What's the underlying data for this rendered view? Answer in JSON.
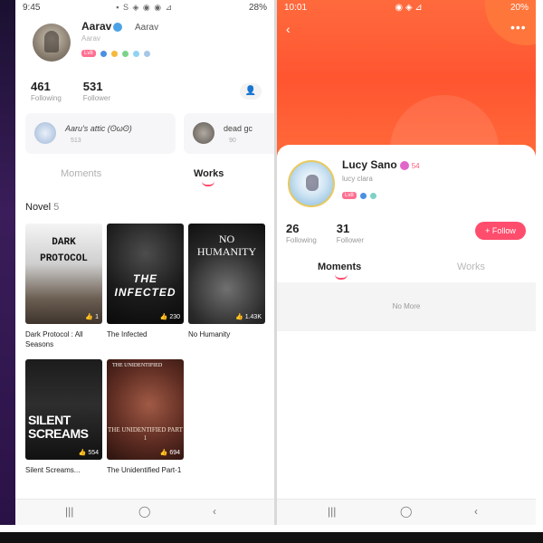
{
  "left_screen": {
    "status": {
      "time": "9:45",
      "battery": "28%",
      "icons": "▪ S ◈ ◉ ◉ ⊿"
    },
    "profile": {
      "name": "Aarav",
      "name_alt": "Aarav",
      "subtitle": "Aarav",
      "level_badge": "Lv8"
    },
    "stats": [
      {
        "value": "461",
        "label": "Following"
      },
      {
        "value": "531",
        "label": "Follower"
      }
    ],
    "add_user_icon": "👤",
    "groups": [
      {
        "name": "Aaru's attic (ʘωʘ)",
        "count": "513"
      },
      {
        "name": "dead gc",
        "count": "90"
      }
    ],
    "tabs": [
      {
        "label": "Moments"
      },
      {
        "label": "Works"
      }
    ],
    "section": {
      "title": "Novel",
      "count": "5"
    },
    "books": [
      {
        "cover_title": "DARK PROTOCOL",
        "title": "Dark Protocol : All Seasons",
        "badge": "1"
      },
      {
        "cover_title": "THE INFECTED",
        "title": "The Infected",
        "badge": "230"
      },
      {
        "cover_title": "NO HUMANITY",
        "title": "No Humanity",
        "badge": "1.43K"
      },
      {
        "cover_title": "SILENT SCREAMS",
        "title": "Silent Screams...",
        "badge": "554"
      },
      {
        "cover_title": "THE UNIDENTIFIED",
        "cover_sub": "THE UNIDENTIFIED PART 1",
        "title": "The Unidentified Part-1",
        "badge": "694"
      }
    ],
    "nav": {
      "recent": "|||",
      "home": "◯",
      "back": "‹"
    }
  },
  "right_screen": {
    "status": {
      "time": "10:01",
      "battery": "20%",
      "icons": "◉ ◈ ⊿"
    },
    "header": {
      "back": "‹",
      "more": "•••"
    },
    "profile": {
      "name": "Lucy Sano",
      "level": "54",
      "handle": "lucy clara",
      "level_badge": "Lv8"
    },
    "stats": [
      {
        "value": "26",
        "label": "Following"
      },
      {
        "value": "31",
        "label": "Follower"
      }
    ],
    "follow_button": "+ Follow",
    "tabs": [
      {
        "label": "Moments"
      },
      {
        "label": "Works"
      }
    ],
    "empty_text": "No More",
    "nav": {
      "recent": "|||",
      "home": "◯",
      "back": "‹"
    }
  },
  "colors": {
    "accent_pink": "#ff4d6d",
    "hero_orange": "#ff5a30"
  }
}
